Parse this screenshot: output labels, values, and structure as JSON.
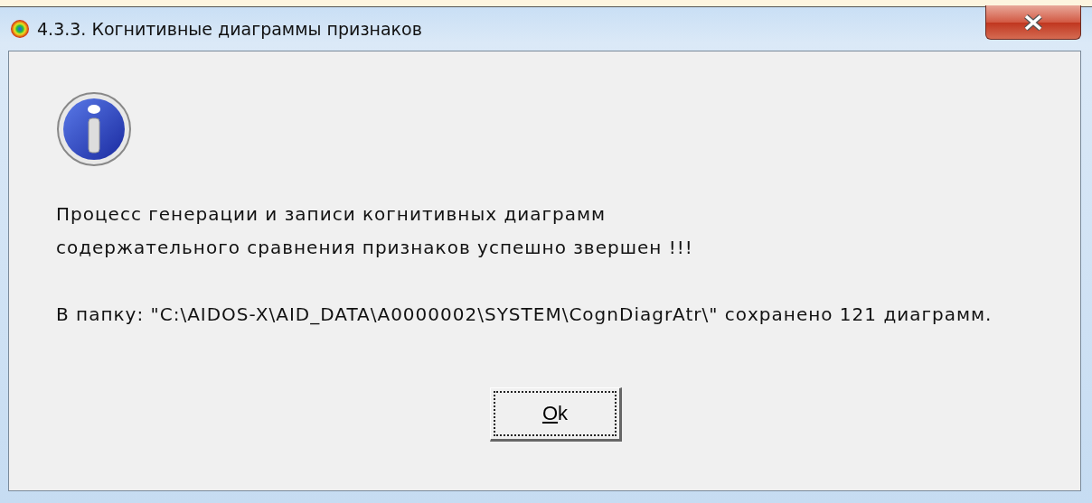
{
  "window": {
    "title": "4.3.3. Когнитивные диаграммы признаков"
  },
  "message": {
    "paragraphs": [
      [
        "Процесс генерации и записи когнитивных диаграмм",
        "содержательного сравнения признаков успешно звершен !!!"
      ],
      [
        "В папку: \"C:\\AIDOS-X\\AID_DATA\\A0000002\\SYSTEM\\CognDiagrAtr\\\" сохранено 121 диаграмм."
      ]
    ]
  },
  "button": {
    "label": "Ok",
    "focused": true,
    "has_mnemonic": true
  }
}
